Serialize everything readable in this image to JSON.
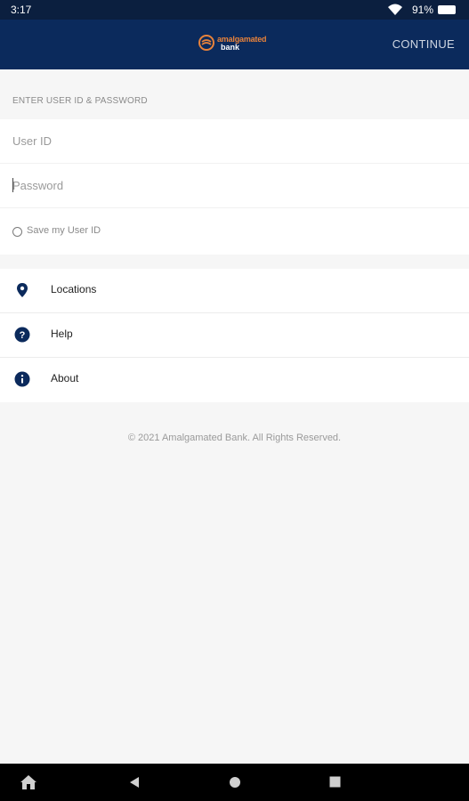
{
  "status_bar": {
    "time": "3:17",
    "battery": "91%",
    "wifi_icon": "wifi-icon",
    "battery_icon": "battery-icon"
  },
  "app_bar": {
    "logo_line1": "amalgamated",
    "logo_line2": "bank",
    "continue_label": "CONTINUE",
    "background": "#0b2a5c",
    "logo_accent": "#e7823b"
  },
  "login": {
    "section_title": "ENTER USER ID & PASSWORD",
    "user_id_placeholder": "User ID",
    "user_id_value": "",
    "password_placeholder": "Password",
    "password_value": "",
    "save_user_id_label": "Save my User ID",
    "save_user_id_checked": false
  },
  "menu": {
    "items": [
      {
        "label": "Locations",
        "icon": "location-pin-icon"
      },
      {
        "label": "Help",
        "icon": "help-icon"
      },
      {
        "label": "About",
        "icon": "info-icon"
      }
    ],
    "icon_color": "#0b2a5c"
  },
  "footer": {
    "copyright": "© 2021 Amalgamated Bank. All Rights Reserved."
  },
  "nav_bar": {
    "buttons": [
      "home-icon",
      "back-icon",
      "home-circle-icon",
      "recents-icon"
    ]
  }
}
